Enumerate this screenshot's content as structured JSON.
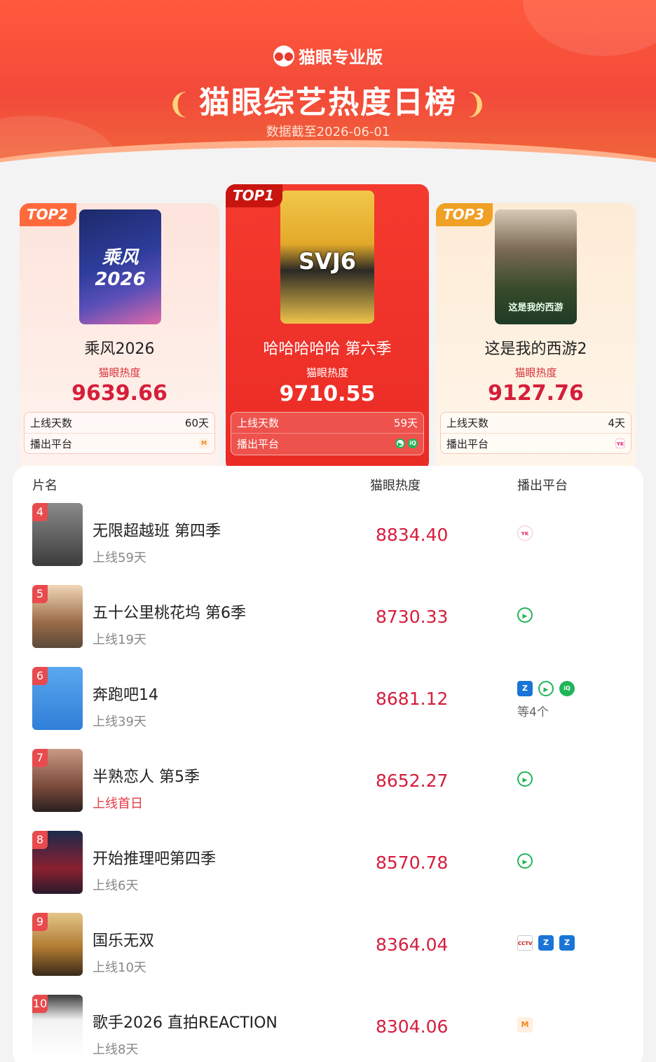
{
  "header": {
    "brand": "猫眼专业版",
    "title": "猫眼综艺热度日榜",
    "subtitle": "数据截至2026-06-01"
  },
  "top3": [
    {
      "rank": "TOP2",
      "poster_text": "乘风2026",
      "title": "乘风2026",
      "label": "猫眼热度",
      "score": "9639.66",
      "days_label": "上线天数",
      "days": "60天",
      "platform_label": "播出平台",
      "platforms": [
        "mango-icon"
      ]
    },
    {
      "rank": "TOP1",
      "poster_text": "SVJ6",
      "title": "哈哈哈哈哈 第六季",
      "label": "猫眼热度",
      "score": "9710.55",
      "days_label": "上线天数",
      "days": "59天",
      "platform_label": "播出平台",
      "platforms": [
        "tencent-video-icon",
        "iqiyi-icon"
      ]
    },
    {
      "rank": "TOP3",
      "poster_text": "这是我的西游",
      "title": "这是我的西游2",
      "label": "猫眼热度",
      "score": "9127.76",
      "days_label": "上线天数",
      "days": "4天",
      "platform_label": "播出平台",
      "platforms": [
        "youku-icon"
      ]
    }
  ],
  "table": {
    "headers": {
      "name": "片名",
      "heat": "猫眼热度",
      "platform": "播出平台"
    },
    "rows": [
      {
        "rank": "4",
        "title": "无限超越班 第四季",
        "days": "上线59天",
        "score": "8834.40",
        "platforms": [
          "youku-icon"
        ],
        "more": ""
      },
      {
        "rank": "5",
        "title": "五十公里桃花坞 第6季",
        "days": "上线19天",
        "score": "8730.33",
        "platforms": [
          "tencent-video-icon"
        ],
        "more": ""
      },
      {
        "rank": "6",
        "title": "奔跑吧14",
        "days": "上线39天",
        "score": "8681.12",
        "platforms": [
          "zhejiang-tv-icon",
          "tencent-video-icon",
          "iqiyi-icon"
        ],
        "more": "等4个"
      },
      {
        "rank": "7",
        "title": "半熟恋人 第5季",
        "days": "上线首日",
        "score": "8652.27",
        "platforms": [
          "tencent-video-icon"
        ],
        "more": ""
      },
      {
        "rank": "8",
        "title": "开始推理吧第四季",
        "days": "上线6天",
        "score": "8570.78",
        "platforms": [
          "tencent-video-icon"
        ],
        "more": ""
      },
      {
        "rank": "9",
        "title": "国乐无双",
        "days": "上线10天",
        "score": "8364.04",
        "platforms": [
          "cctv-icon",
          "zhejiang-tv-icon",
          "zhejiang-tv-icon"
        ],
        "more": ""
      },
      {
        "rank": "10",
        "title": "歌手2026 直拍REACTION",
        "days": "上线8天",
        "score": "8304.06",
        "platforms": [
          "mango-icon"
        ],
        "more": ""
      }
    ]
  },
  "colors": {
    "accent": "#f24a3a",
    "score": "#d61d3c",
    "top2_tag": "#ff6a3c",
    "top3_tag": "#f0a024"
  }
}
